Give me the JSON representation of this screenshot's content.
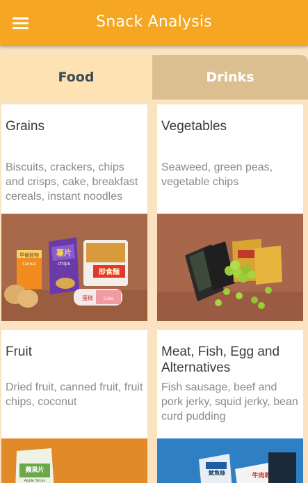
{
  "header": {
    "title": "Snack Analysis",
    "menu_icon": "hamburger-menu-icon"
  },
  "tabs": [
    {
      "label": "Food",
      "selected": true
    },
    {
      "label": "Drinks",
      "selected": false
    }
  ],
  "colors": {
    "appbar": "#f5a623",
    "tab_selected": "#fde2b4",
    "tab_unselected": "#dcbf90",
    "background": "#fbe3c1"
  },
  "categories": [
    {
      "title": "Grains",
      "description": "Biscuits, crackers, chips and crisps, cake, breakfast cereals, instant noodles",
      "photo_labels": {
        "chips": "薯片",
        "chips_sub": "chips",
        "noodles": "即食麵",
        "cereal": "早餐穀物",
        "cereal_sub": "Cereal",
        "cake": "蛋糕",
        "cake_sub": "Cake"
      }
    },
    {
      "title": "Vegetables",
      "description": "Seaweed, green peas, vegetable chips",
      "photo_labels": {}
    },
    {
      "title": "Fruit",
      "description": "Dried fruit, canned fruit, fruit chips, coconut",
      "photo_labels": {
        "bag": "蘋果片",
        "bag_sub": "Apple Slices"
      }
    },
    {
      "title": "Meat, Fish, Egg and Alternatives",
      "description": "Fish sausage, beef and pork jerky, squid jerky, bean curd pudding",
      "photo_labels": {
        "squid": "魷魚絲",
        "beef": "牛肉乾"
      }
    }
  ]
}
